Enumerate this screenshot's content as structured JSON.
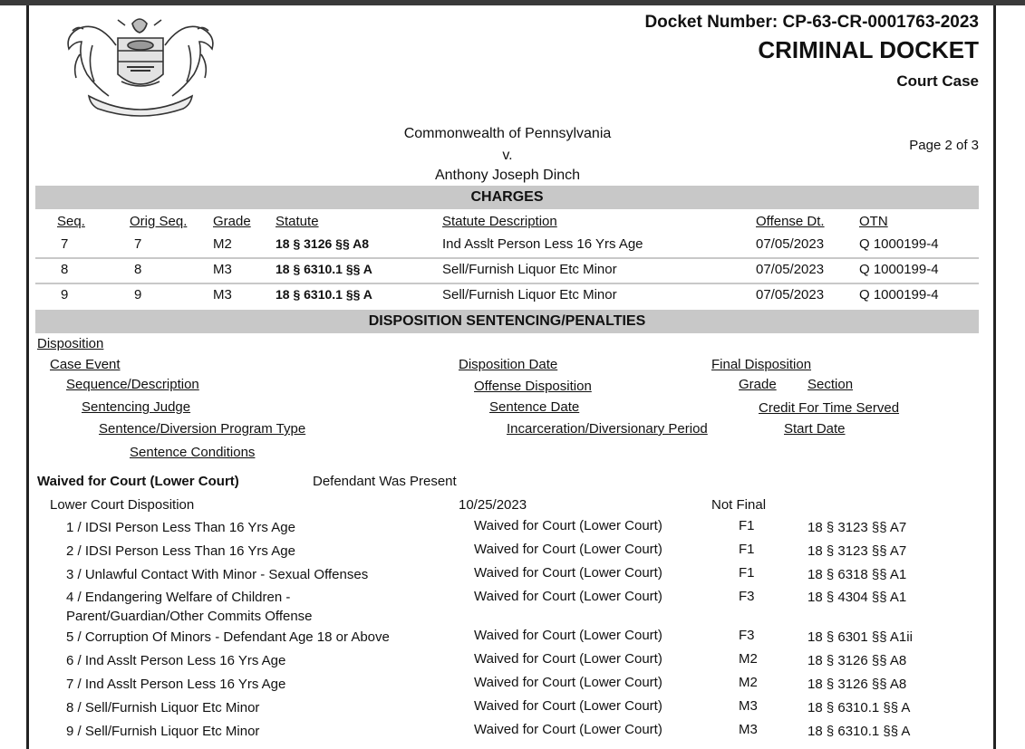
{
  "header": {
    "docket_number": "Docket Number: CP-63-CR-0001763-2023",
    "doc_type": "CRIMINAL DOCKET",
    "case_type": "Court Case",
    "caption_line1": "Commonwealth of Pennsylvania",
    "caption_line2": "v.",
    "caption_line3": "Anthony Joseph Dinch",
    "page_label": "Page 2 of 3"
  },
  "charges": {
    "title": "CHARGES",
    "columns": [
      "Seq.",
      "Orig Seq.",
      "Grade",
      "Statute",
      "Statute Description",
      "Offense Dt.",
      "OTN"
    ],
    "rows": [
      {
        "seq": "7",
        "orig": "7",
        "grade": "M2",
        "statute": "18 § 3126 §§ A8",
        "desc": "Ind Asslt Person Less 16 Yrs Age",
        "date": "07/05/2023",
        "otn": "Q 1000199-4"
      },
      {
        "seq": "8",
        "orig": "8",
        "grade": "M3",
        "statute": "18 § 6310.1 §§ A",
        "desc": "Sell/Furnish Liquor Etc Minor",
        "date": "07/05/2023",
        "otn": "Q 1000199-4"
      },
      {
        "seq": "9",
        "orig": "9",
        "grade": "M3",
        "statute": "18 § 6310.1 §§ A",
        "desc": "Sell/Furnish Liquor Etc Minor",
        "date": "07/05/2023",
        "otn": "Q 1000199-4"
      }
    ]
  },
  "disposition": {
    "title": "DISPOSITION SENTENCING/PENALTIES",
    "legend": {
      "disposition": "Disposition",
      "case_event": "Case Event",
      "disposition_date": "Disposition Date",
      "final_disposition": "Final Disposition",
      "sequence_description": "Sequence/Description",
      "offense_disposition": "Offense Disposition",
      "grade": "Grade",
      "section": "Section",
      "sentencing_judge": "Sentencing Judge",
      "sentence_date": "Sentence Date",
      "credit_time": "Credit For Time Served",
      "program_type": "Sentence/Diversion Program Type",
      "incarceration_period": "Incarceration/Diversionary Period",
      "start_date": "Start Date",
      "sentence_conditions": "Sentence Conditions"
    },
    "block": {
      "name": "Waived for Court (Lower Court)",
      "presence": "Defendant Was Present",
      "event": "Lower Court Disposition",
      "event_date": "10/25/2023",
      "final": "Not Final"
    },
    "offenses": [
      {
        "desc": "1 / IDSI Person Less Than 16 Yrs Age",
        "desc2": "",
        "disp": "Waived for Court (Lower Court)",
        "grade": "F1",
        "section": "18 § 3123 §§ A7"
      },
      {
        "desc": "2 / IDSI Person Less Than 16 Yrs Age",
        "desc2": "",
        "disp": "Waived for Court (Lower Court)",
        "grade": "F1",
        "section": "18 § 3123 §§ A7"
      },
      {
        "desc": "3 / Unlawful Contact With Minor - Sexual Offenses",
        "desc2": "",
        "disp": "Waived for Court (Lower Court)",
        "grade": "F1",
        "section": "18 § 6318 §§ A1"
      },
      {
        "desc": "4 / Endangering Welfare of Children -",
        "desc2": "Parent/Guardian/Other Commits Offense",
        "disp": "Waived for Court (Lower Court)",
        "grade": "F3",
        "section": "18 § 4304 §§ A1"
      },
      {
        "desc": "5 / Corruption Of Minors - Defendant Age 18 or Above",
        "desc2": "",
        "disp": "Waived for Court (Lower Court)",
        "grade": "F3",
        "section": "18 § 6301 §§ A1ii"
      },
      {
        "desc": "6 / Ind Asslt Person Less 16 Yrs Age",
        "desc2": "",
        "disp": "Waived for Court (Lower Court)",
        "grade": "M2",
        "section": "18 § 3126 §§ A8"
      },
      {
        "desc": "7 / Ind Asslt Person Less 16 Yrs Age",
        "desc2": "",
        "disp": "Waived for Court (Lower Court)",
        "grade": "M2",
        "section": "18 § 3126 §§ A8"
      },
      {
        "desc": "8 / Sell/Furnish Liquor Etc Minor",
        "desc2": "",
        "disp": "Waived for Court (Lower Court)",
        "grade": "M3",
        "section": "18 § 6310.1 §§ A"
      },
      {
        "desc": "9 / Sell/Furnish Liquor Etc Minor",
        "desc2": "",
        "disp": "Waived for Court (Lower Court)",
        "grade": "M3",
        "section": "18 § 6310.1 §§ A"
      }
    ]
  }
}
